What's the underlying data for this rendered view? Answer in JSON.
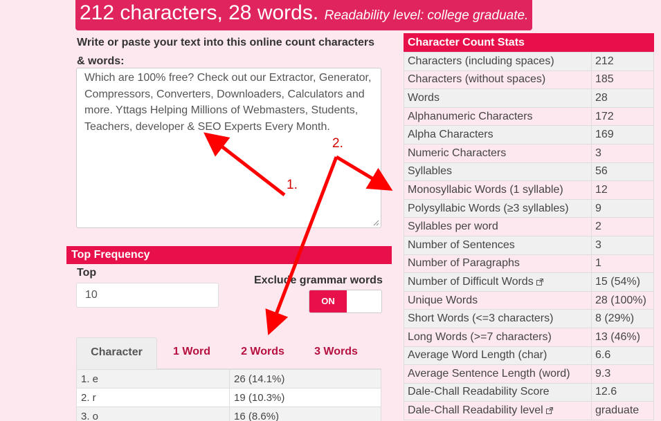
{
  "summary": {
    "count_text": "212 characters, 28 words.",
    "readability_text": "Readability level: college graduate."
  },
  "editor": {
    "prompt": "Write or paste your text into this online count characters & words:",
    "text": "Which are 100% free? Check out our Extractor, Generator, Compressors, Converters, Downloaders, Calculators and more. Yttags Helping Millions of Webmasters, Students, Teachers, developer & SEO Experts Every Month."
  },
  "frequency": {
    "title": "Top Frequency",
    "top_label": "Top",
    "top_value": "10",
    "exclude_label": "Exclude grammar words",
    "toggle_label": "ON",
    "tabs": [
      "Character",
      "1 Word",
      "2 Words",
      "3 Words"
    ],
    "rows": [
      {
        "item": "1. e",
        "count": "26 (14.1%)"
      },
      {
        "item": "2. r",
        "count": "19 (10.3%)"
      },
      {
        "item": "3. o",
        "count": "16 (8.6%)"
      }
    ]
  },
  "stats": {
    "title": "Character Count Stats",
    "rows": [
      {
        "label": "Characters (including spaces)",
        "value": "212"
      },
      {
        "label": "Characters (without spaces)",
        "value": "185"
      },
      {
        "label": "Words",
        "value": "28"
      },
      {
        "label": "Alphanumeric Characters",
        "value": "172"
      },
      {
        "label": "Alpha Characters",
        "value": "169"
      },
      {
        "label": "Numeric Characters",
        "value": "3"
      },
      {
        "label": "Syllables",
        "value": "56"
      },
      {
        "label": "Monosyllabic Words (1 syllable)",
        "value": "12"
      },
      {
        "label": "Polysyllabic Words (≥3 syllables)",
        "value": "9"
      },
      {
        "label": "Syllables per word",
        "value": "2"
      },
      {
        "label": "Number of Sentences",
        "value": "3"
      },
      {
        "label": "Number of Paragraphs",
        "value": "1"
      },
      {
        "label": "Number of Difficult Words",
        "value": "15 (54%)",
        "link": true
      },
      {
        "label": "Unique Words",
        "value": "28 (100%)"
      },
      {
        "label": "Short Words (<=3 characters)",
        "value": "8 (29%)"
      },
      {
        "label": "Long Words (>=7 characters)",
        "value": "13 (46%)"
      },
      {
        "label": "Average Word Length (char)",
        "value": "6.6"
      },
      {
        "label": "Average Sentence Length (word)",
        "value": "9.3"
      },
      {
        "label": "Dale-Chall Readability Score",
        "value": "12.6"
      },
      {
        "label": "Dale-Chall Readability level",
        "value": "graduate",
        "link": true
      }
    ]
  },
  "annotations": {
    "label_1": "1.",
    "label_2": "2.",
    "color": "#ff0000"
  },
  "colors": {
    "accent": "#e8104a",
    "summary_bg": "#e0245e",
    "tab_text": "#b5103f",
    "page_bg": "#fde8ef"
  }
}
